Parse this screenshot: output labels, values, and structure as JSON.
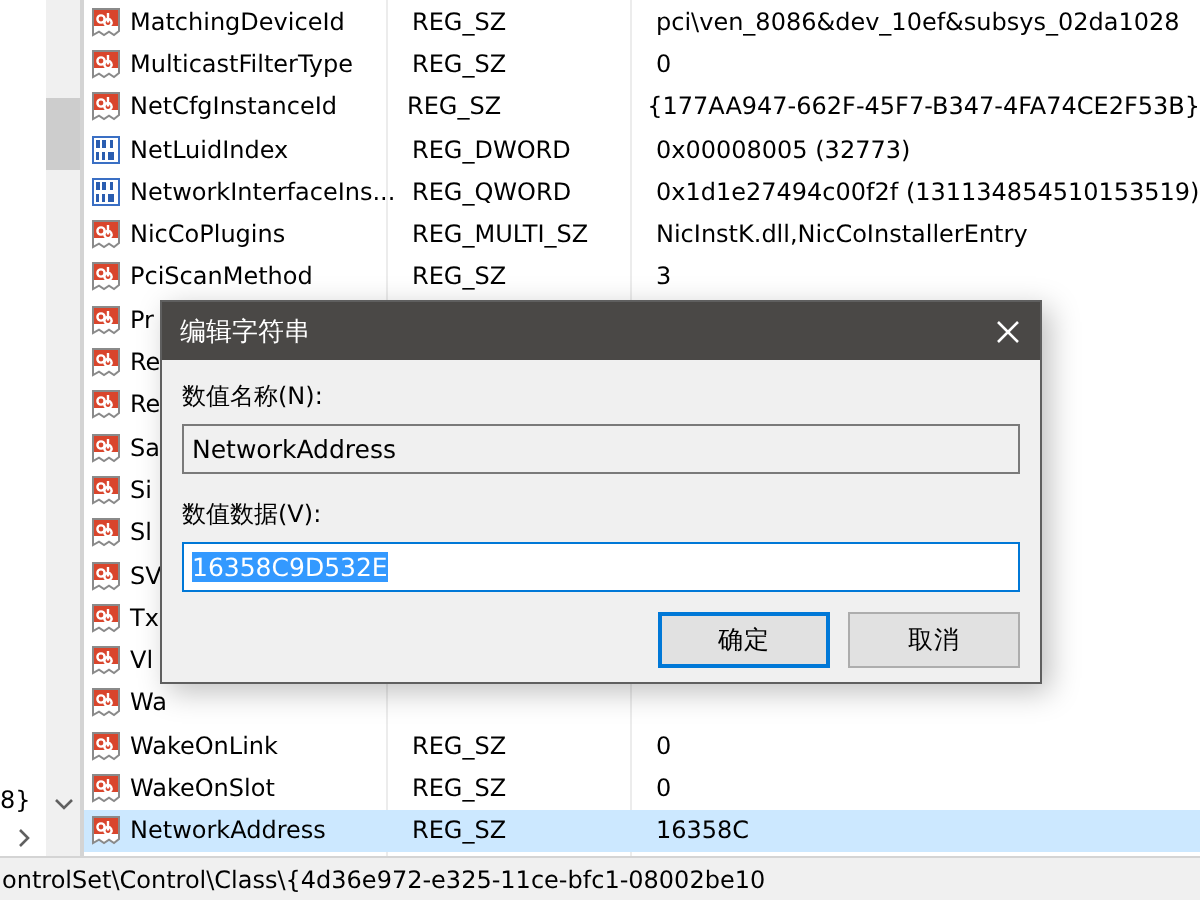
{
  "tree": {
    "fragment": "8}"
  },
  "list": {
    "rows": [
      {
        "name": "MatchingDeviceId",
        "type": "REG_SZ",
        "data": "pci\\ven_8086&dev_10ef&subsys_02da1028",
        "kind": "string",
        "selected": false
      },
      {
        "name": "MulticastFilterType",
        "type": "REG_SZ",
        "data": "0",
        "kind": "string",
        "selected": false
      },
      {
        "name": "NetCfgInstanceId",
        "type": "REG_SZ",
        "data": "{177AA947-662F-45F7-B347-4FA74CE2F53B}",
        "kind": "string",
        "selected": false
      },
      {
        "name": "NetLuidIndex",
        "type": "REG_DWORD",
        "data": "0x00008005 (32773)",
        "kind": "binary",
        "selected": false
      },
      {
        "name": "NetworkInterfaceIns...",
        "type": "REG_QWORD",
        "data": "0x1d1e27494c00f2f (131134854510153519)",
        "kind": "binary",
        "selected": false
      },
      {
        "name": "NicCoPlugins",
        "type": "REG_MULTI_SZ",
        "data": "NicInstK.dll,NicCoInstallerEntry",
        "kind": "string",
        "selected": false
      },
      {
        "name": "PciScanMethod",
        "type": "REG_SZ",
        "data": "3",
        "kind": "string",
        "selected": false
      },
      {
        "name": "Pr",
        "kind": "string",
        "selected": false
      },
      {
        "name": "Re",
        "kind": "string",
        "selected": false
      },
      {
        "name": "Re",
        "kind": "string",
        "selected": false
      },
      {
        "name": "Sa",
        "kind": "string",
        "selected": false
      },
      {
        "name": "Si",
        "kind": "string",
        "selected": false
      },
      {
        "name": "Sl",
        "kind": "string",
        "selected": false
      },
      {
        "name": "SV",
        "kind": "string",
        "selected": false
      },
      {
        "name": "Tx",
        "kind": "string",
        "selected": false
      },
      {
        "name": "Vl",
        "kind": "string",
        "selected": false
      },
      {
        "name": "Wa",
        "kind": "string",
        "selected": false
      },
      {
        "name": "WakeOnLink",
        "type": "REG_SZ",
        "data": "0",
        "kind": "string",
        "selected": false
      },
      {
        "name": "WakeOnSlot",
        "type": "REG_SZ",
        "data": "0",
        "kind": "string",
        "selected": false
      },
      {
        "name": "NetworkAddress",
        "type": "REG_SZ",
        "data": "16358C",
        "kind": "string",
        "selected": true
      }
    ]
  },
  "status_bar": "ontrolSet\\Control\\Class\\{4d36e972-e325-11ce-bfc1-08002be10",
  "dialog": {
    "title": "编辑字符串",
    "name_label": "数值名称(N):",
    "name_value": "NetworkAddress",
    "data_label": "数值数据(V):",
    "data_value": "16358C9D532E",
    "buttons": [
      {
        "label": "确定",
        "default": true
      },
      {
        "label": "取消",
        "default": false
      }
    ]
  }
}
